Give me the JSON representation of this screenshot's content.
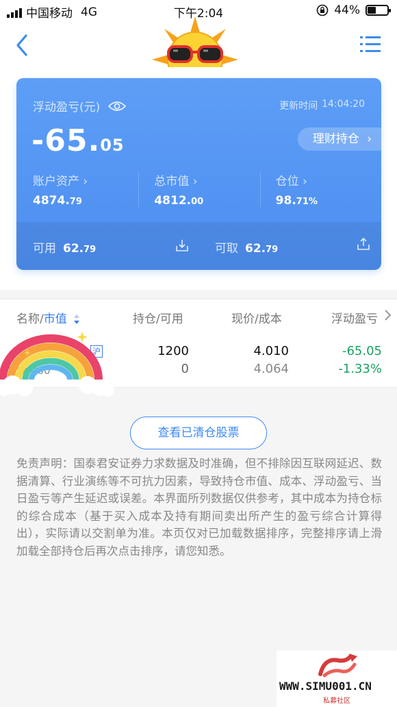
{
  "status_bar": {
    "carrier": "中国移动",
    "network": "4G",
    "time": "下午2:04",
    "battery": "44%",
    "battery_level": 0.44
  },
  "card": {
    "pnl_label": "浮动盈亏(元)",
    "update_label": "更新时间",
    "update_time": "14:04:20",
    "pnl_int": "-65.",
    "pnl_dec": "05",
    "holdings_button": "理财持仓",
    "stats": [
      {
        "label": "账户资产",
        "int": "4874.",
        "dec": "79"
      },
      {
        "label": "总市值",
        "int": "4812.",
        "dec": "00"
      },
      {
        "label": "仓位",
        "int": "98.",
        "dec": "71%"
      }
    ],
    "available_label": "可用",
    "available_int": "62.",
    "available_dec": "79",
    "withdrawable_label": "可取",
    "withdrawable_int": "62.",
    "withdrawable_dec": "79"
  },
  "table": {
    "header_name": "名称/",
    "header_mv": "市值",
    "header_hold": "持仓/可用",
    "header_price": "现价/成本",
    "header_pnl": "浮动盈亏",
    "rows": [
      {
        "tag": "沪",
        "market_value": "4812.000",
        "holding": "1200",
        "available": "0",
        "price": "4.010",
        "cost": "4.064",
        "pnl": "-65.05",
        "pnl_pct": "-1.33%"
      }
    ]
  },
  "cleared_button": "查看已清仓股票",
  "disclaimer": "免责声明：国泰君安证券力求数据及时准确，但不排除因互联网延迟、数据清算、行业演练等不可抗力因素，导致持仓市值、成本、浮动盈亏、当日盈亏等产生延迟或误差。本界面所列数据仅供参考，其中成本为持仓标的综合成本（基于买入成本及持有期间卖出所产生的盈亏综合计算得出），实际请以交割单为准。本页仅对已加载数据排序，完整排序请上滑加载全部持仓后再次点击排序，请您知悉。",
  "watermark": {
    "text": "WWW.SIMU001.CN",
    "sub": "私募社区"
  },
  "colors": {
    "accent": "#3b7ee8",
    "card": "#5d9ef7",
    "down": "#1aa060"
  }
}
